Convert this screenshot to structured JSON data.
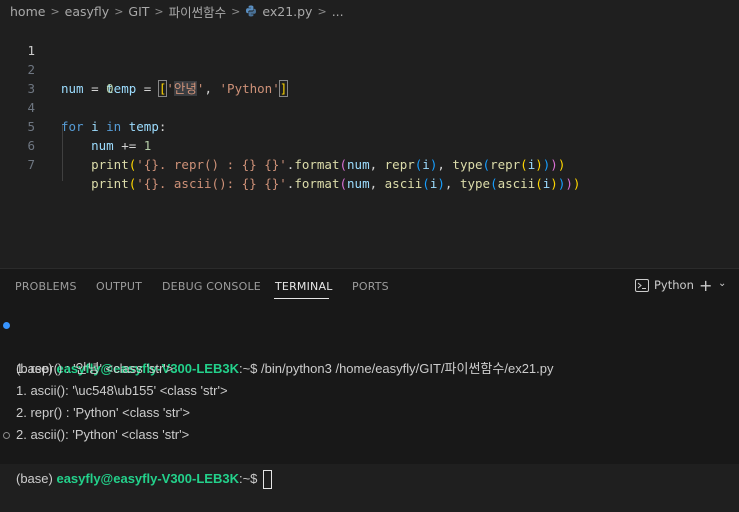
{
  "breadcrumb": {
    "items": [
      "home",
      "easyfly",
      "GIT",
      "파이썬함수"
    ],
    "file": "ex21.py",
    "ellipsis": "..."
  },
  "editor": {
    "line_numbers": [
      "1",
      "2",
      "3",
      "4",
      "5",
      "6",
      "7"
    ],
    "lines": {
      "l1": {
        "temp": "temp",
        "eq": " = ",
        "lb": "[",
        "q1": "'",
        "s1": "안녕",
        "q2": "'",
        "comma": ", ",
        "s2": "'Python'",
        "rb": "]"
      },
      "l2": {
        "var": "num",
        "eq": " = ",
        "num": "0"
      },
      "l4": {
        "for": "for",
        "i": " i ",
        "in": "in",
        "temp": " temp",
        "colon": ":"
      },
      "l5": {
        "indent": "    ",
        "var": "num",
        "op": " += ",
        "num": "1"
      },
      "l6": {
        "indent": "    ",
        "print": "print",
        "p1o": "(",
        "str": "'{}. repr() : {} {}'",
        "dot": ".",
        "format": "format",
        "p2o": "(",
        "num": "num",
        "c1": ", ",
        "repr": "repr",
        "p3o": "(",
        "i": "i",
        "p3c": ")",
        "c2": ", ",
        "type": "type",
        "p3o2": "(",
        "repr2": "repr",
        "p1o2": "(",
        "i2": "i",
        "p1c2": ")",
        "p3c2": ")",
        "p2c": ")",
        "p1c": ")"
      },
      "l7": {
        "indent": "    ",
        "print": "print",
        "p1o": "(",
        "str": "'{}. ascii(): {} {}'",
        "dot": ".",
        "format": "format",
        "p2o": "(",
        "num": "num",
        "c1": ", ",
        "ascii": "ascii",
        "p3o": "(",
        "i": "i",
        "p3c": ")",
        "c2": ", ",
        "type": "type",
        "p3o2": "(",
        "ascii2": "ascii",
        "p1o2": "(",
        "i2": "i",
        "p1c2": ")",
        "p3c2": ")",
        "p2c": ")",
        "p1c": ")"
      }
    }
  },
  "panel": {
    "tabs": [
      "PROBLEMS",
      "OUTPUT",
      "DEBUG CONSOLE",
      "TERMINAL",
      "PORTS"
    ],
    "active_tab": "TERMINAL",
    "terminal_label": "Python"
  },
  "terminal": {
    "prompt_env": "(base) ",
    "user_host": "easyfly@easyfly-V300-LEB3K",
    "prompt_path": ":~$ ",
    "command": "/bin/python3 /home/easyfly/GIT/파이썬함수/ex21.py",
    "outputs": [
      "1. repr() : '안녕' <class 'str'>",
      "1. ascii(): '\\uc548\\ub155' <class 'str'>",
      "2. repr() : 'Python' <class 'str'>",
      "2. ascii(): 'Python' <class 'str'>"
    ]
  },
  "colors": {
    "editor_bg": "#1f1f1f",
    "panel_bg": "#181818",
    "user_green": "#23d18b",
    "keyword_blue": "#569cd6",
    "string_orange": "#ce9178"
  }
}
